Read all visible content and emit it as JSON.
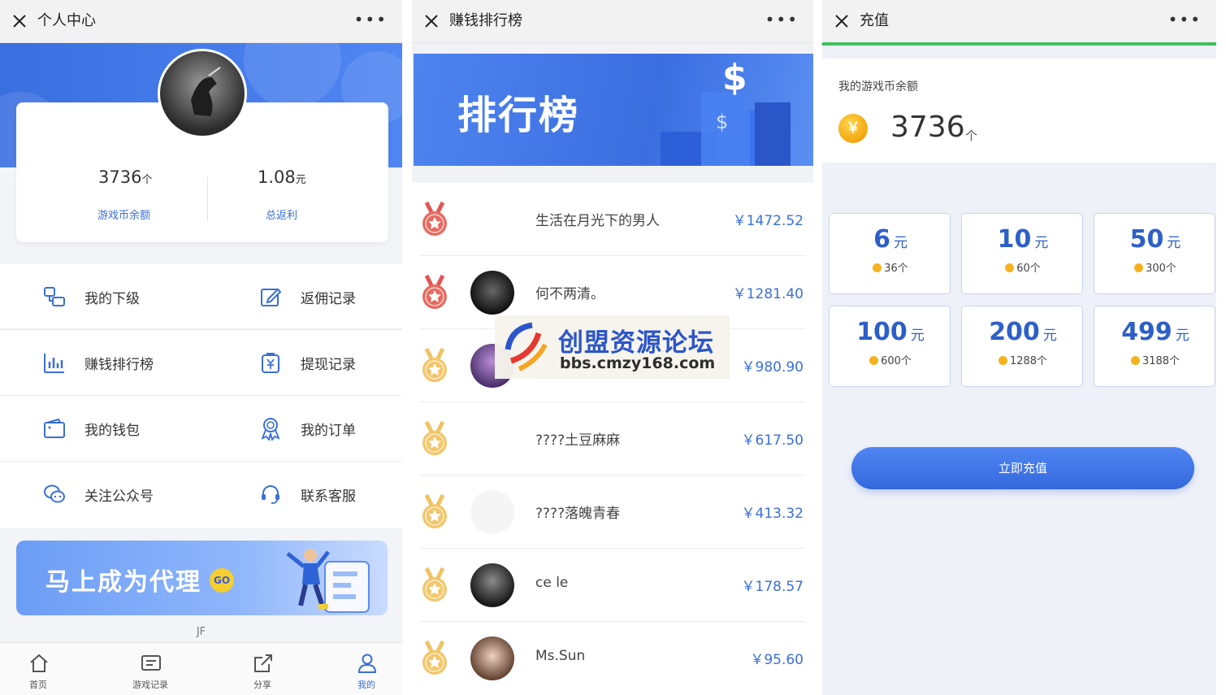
{
  "panel_profile": {
    "title": "个人中心",
    "balance_value": "3736",
    "balance_unit": "个",
    "balance_label": "游戏币余额",
    "rebate_value": "1.08",
    "rebate_unit": "元",
    "rebate_label": "总返利",
    "menu": [
      {
        "label": "我的下级",
        "icon": "users-icon"
      },
      {
        "label": "返佣记录",
        "icon": "edit-icon"
      },
      {
        "label": "赚钱排行榜",
        "icon": "bar-chart-icon"
      },
      {
        "label": "提现记录",
        "icon": "withdraw-icon"
      },
      {
        "label": "我的钱包",
        "icon": "wallet-icon"
      },
      {
        "label": "我的订单",
        "icon": "badge-icon"
      },
      {
        "label": "关注公众号",
        "icon": "wechat-icon"
      },
      {
        "label": "联系客服",
        "icon": "headset-icon"
      }
    ],
    "banner_text": "马上成为代理",
    "banner_go": "GO",
    "footer_text": "JF",
    "tabs": [
      {
        "label": "首页",
        "icon": "home-icon"
      },
      {
        "label": "游戏记录",
        "icon": "record-icon"
      },
      {
        "label": "分享",
        "icon": "share-icon"
      },
      {
        "label": "我的",
        "icon": "user-icon",
        "active": true
      }
    ],
    "accent_color": "#3a6fd8"
  },
  "panel_ranking": {
    "title": "赚钱排行榜",
    "banner_title": "排行榜",
    "rows": [
      {
        "name": "生活在月光下的男人",
        "amount": "￥1472.52",
        "medal": "red"
      },
      {
        "name": "何不两清。",
        "amount": "￥1281.40",
        "medal": "red"
      },
      {
        "name": "",
        "amount": "￥980.90",
        "medal": "gold"
      },
      {
        "name": "????土豆麻麻",
        "amount": "￥617.50",
        "medal": "gold"
      },
      {
        "name": "????落魄青春",
        "amount": "￥413.32",
        "medal": "gold"
      },
      {
        "name": "ce le",
        "amount": "￥178.57",
        "medal": "gold"
      },
      {
        "name": "Ms.Sun",
        "amount": "￥95.60",
        "medal": "gold"
      }
    ],
    "watermark_title": "创盟资源论坛",
    "watermark_url": "bbs.cmzy168.com"
  },
  "panel_recharge": {
    "title": "充值",
    "progress": 1.0,
    "balance_label": "我的游戏币余额",
    "coin_symbol": "￥",
    "balance_value": "3736",
    "balance_unit": "个",
    "yuan": "元",
    "options": [
      {
        "price": "6",
        "coins": "36个"
      },
      {
        "price": "10",
        "coins": "60个"
      },
      {
        "price": "50",
        "coins": "300个"
      },
      {
        "price": "100",
        "coins": "600个"
      },
      {
        "price": "200",
        "coins": "1288个"
      },
      {
        "price": "499",
        "coins": "3188个"
      }
    ],
    "pay_button": "立即充值",
    "progress_color": "#3fbf5b"
  }
}
